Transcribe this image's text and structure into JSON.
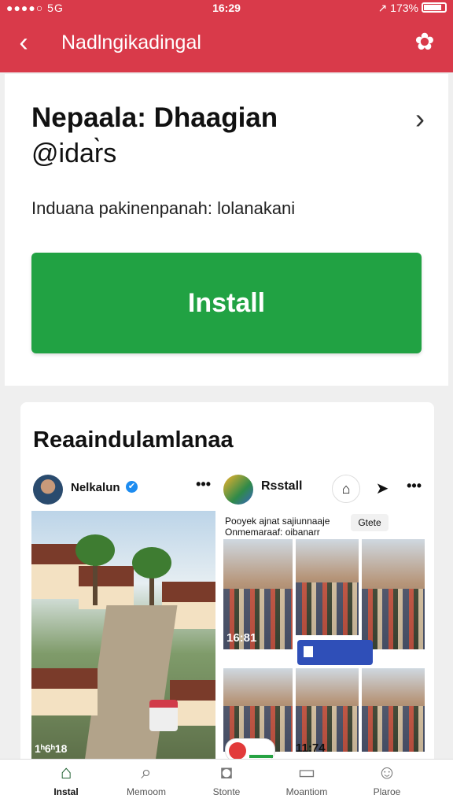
{
  "status_bar": {
    "signal": "●●●●○ 5G",
    "time": "16:29",
    "battery": "↗ 173%"
  },
  "app_bar": {
    "title": "Nadlngikadingal",
    "back_icon": "chevron-left-icon",
    "settings_icon": "flower-settings-icon"
  },
  "header_card": {
    "name": "Nepaala: Dhaagian",
    "handle": "@idar̀s",
    "description": "Induana pakinenpanah: lolanakani",
    "install_label": "Install",
    "install_color": "#21a243"
  },
  "feed": {
    "section_title": "Reaaindulamlanaa",
    "post_a": {
      "username": "Nelkalun",
      "verified": "✔",
      "more": "•••",
      "timestamp": "1ʰ6ʰ18"
    },
    "post_b": {
      "username": "Rsstall",
      "more": "•••",
      "caption": "Pooyek ajnat sajiunnaaje Onmemaraaf: oibanarr",
      "tag": "Gtete",
      "timestamps": [
        "16:81",
        "11:74"
      ]
    }
  },
  "bottom_nav": {
    "items": [
      {
        "label": "Instal",
        "icon": "home-icon"
      },
      {
        "label": "Memoom",
        "icon": "search-icon"
      },
      {
        "label": "Stonte",
        "icon": "notification-icon"
      },
      {
        "label": "Moantiom",
        "icon": "chat-icon"
      },
      {
        "label": "Plaroe",
        "icon": "profile-icon"
      }
    ]
  },
  "colors": {
    "brand_red": "#d93a4a",
    "install_green": "#21a243",
    "verified_blue": "#1d8cf0"
  }
}
